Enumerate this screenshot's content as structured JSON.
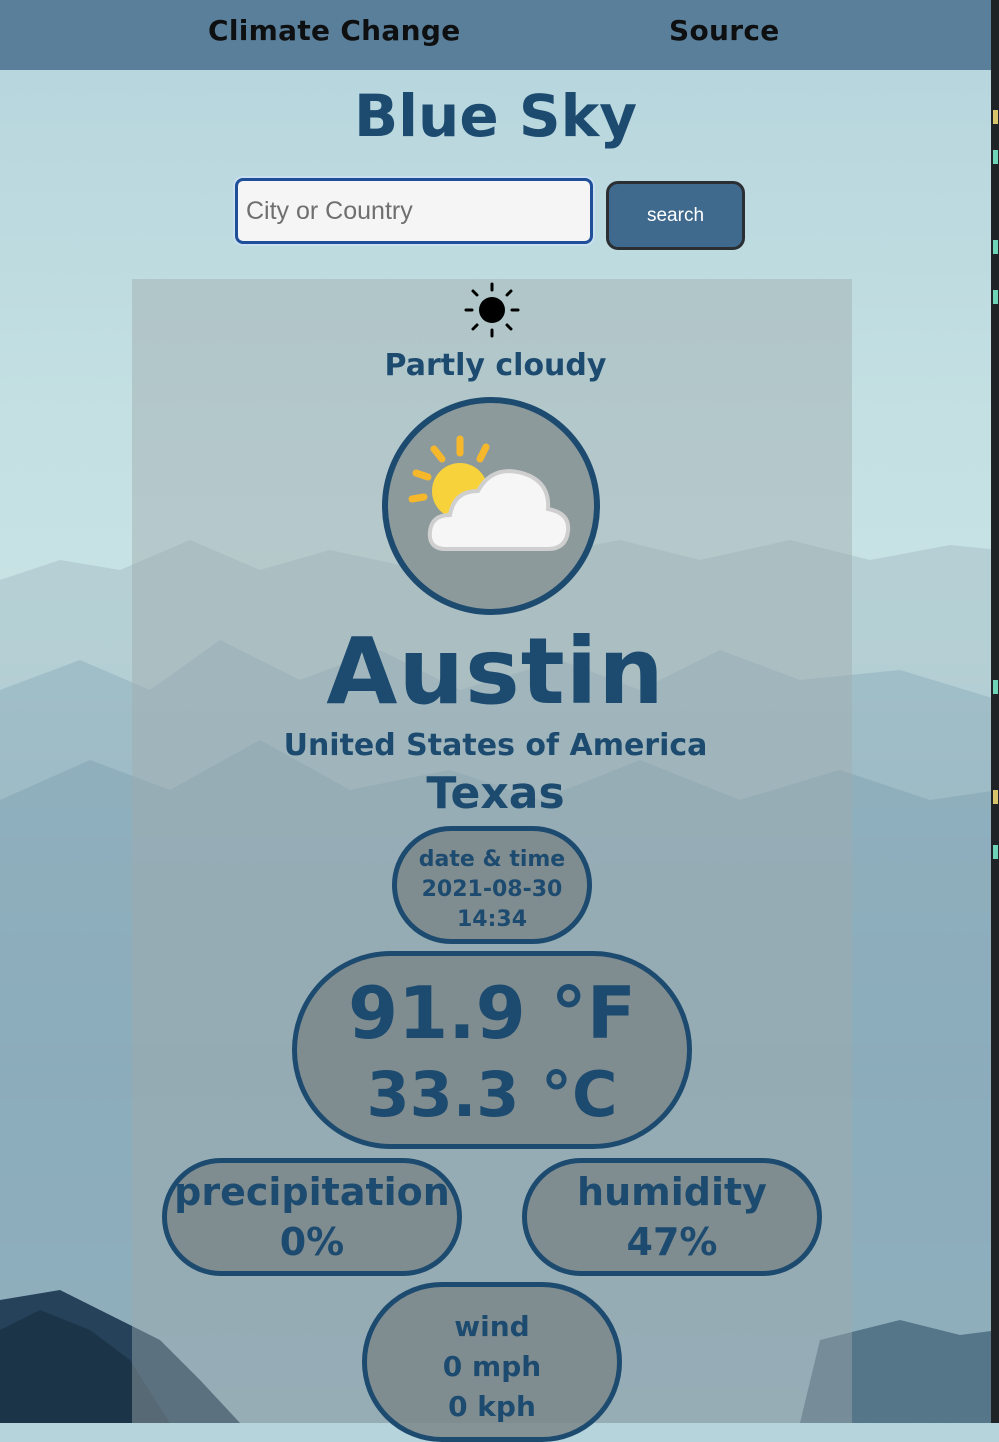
{
  "nav": {
    "climate_change": "Climate Change",
    "source": "Source"
  },
  "app": {
    "title": "Blue Sky"
  },
  "search": {
    "placeholder": "City or Country",
    "value": "",
    "button_label": "search"
  },
  "weather": {
    "condition_icon": "sun-icon",
    "condition": "Partly cloudy",
    "image_icon": "partly-cloudy-icon",
    "city": "Austin",
    "country": "United States of America",
    "region": "Texas",
    "datetime": {
      "label": "date & time",
      "date": "2021-08-30",
      "time": "14:34"
    },
    "temp_f": "91.9 °F",
    "temp_c": "33.3 °C",
    "precipitation": {
      "label": "precipitation",
      "value": "0%"
    },
    "humidity": {
      "label": "humidity",
      "value": "47%"
    },
    "wind": {
      "label": "wind",
      "mph": "0 mph",
      "kph": "0 kph"
    }
  },
  "colors": {
    "accent": "#1d4b70",
    "topbar": "#5a7f9a",
    "button": "#40698e"
  }
}
